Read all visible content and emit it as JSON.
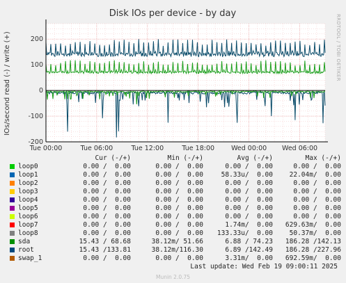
{
  "chart_data": {
    "type": "line",
    "title": "Disk IOs per device - by day",
    "ylabel": "IOs/second read (-) / write (+)",
    "ylim": [
      -200,
      260
    ],
    "yticks": [
      -200,
      -100,
      0,
      100,
      200
    ],
    "x_tick_labels": [
      "Tue 00:00",
      "Tue 06:00",
      "Tue 12:00",
      "Tue 18:00",
      "Wed 00:00",
      "Wed 06:00"
    ],
    "x_range_hours": [
      0,
      33
    ],
    "grid": true,
    "series": [
      {
        "name": "root",
        "color": "#0b4c6a",
        "write_typical": 140,
        "write_peak": 200,
        "read_typical": -10,
        "read_peak": -185
      },
      {
        "name": "sda",
        "color": "#1b9e1b",
        "write_typical": 70,
        "write_peak": 118,
        "read_typical": -5,
        "read_peak": -60
      }
    ]
  },
  "side_text": "RRDTOOL / TOBI OETIKER",
  "legend": {
    "headers": {
      "cur": "Cur (-/+)",
      "min": "Min (-/+)",
      "avg": "Avg (-/+)",
      "max": "Max (-/+)"
    },
    "rows": [
      {
        "name": "loop0",
        "color": "#00cc00",
        "cur": "0.00 /  0.00",
        "min": "0.00 /  0.00",
        "avg": "0.00 /  0.00",
        "max": "0.00 /  0.00"
      },
      {
        "name": "loop1",
        "color": "#0066b3",
        "cur": "0.00 /  0.00",
        "min": "0.00 /  0.00",
        "avg": "58.33u/  0.00",
        "max": "22.04m/  0.00"
      },
      {
        "name": "loop2",
        "color": "#ff8000",
        "cur": "0.00 /  0.00",
        "min": "0.00 /  0.00",
        "avg": "0.00 /  0.00",
        "max": "0.00 /  0.00"
      },
      {
        "name": "loop3",
        "color": "#ffcc00",
        "cur": "0.00 /  0.00",
        "min": "0.00 /  0.00",
        "avg": "0.00 /  0.00",
        "max": "0.00 /  0.00"
      },
      {
        "name": "loop4",
        "color": "#330099",
        "cur": "0.00 /  0.00",
        "min": "0.00 /  0.00",
        "avg": "0.00 /  0.00",
        "max": "0.00 /  0.00"
      },
      {
        "name": "loop5",
        "color": "#990099",
        "cur": "0.00 /  0.00",
        "min": "0.00 /  0.00",
        "avg": "0.00 /  0.00",
        "max": "0.00 /  0.00"
      },
      {
        "name": "loop6",
        "color": "#ccff00",
        "cur": "0.00 /  0.00",
        "min": "0.00 /  0.00",
        "avg": "0.00 /  0.00",
        "max": "0.00 /  0.00"
      },
      {
        "name": "loop7",
        "color": "#ff0000",
        "cur": "0.00 /  0.00",
        "min": "0.00 /  0.00",
        "avg": "1.74m/  0.00",
        "max": "629.63m/  0.00"
      },
      {
        "name": "loop8",
        "color": "#808080",
        "cur": "0.00 /  0.00",
        "min": "0.00 /  0.00",
        "avg": "133.33u/  0.00",
        "max": "50.37m/  0.00"
      },
      {
        "name": "sda",
        "color": "#008f00",
        "cur": "15.43 / 68.68",
        "min": "38.12m/ 51.66",
        "avg": "6.88 / 74.23",
        "max": "186.28 /142.13"
      },
      {
        "name": "root",
        "color": "#00487d",
        "cur": "15.43 /133.81",
        "min": "38.12m/116.30",
        "avg": "6.89 /142.49",
        "max": "186.28 /227.96"
      },
      {
        "name": "swap_1",
        "color": "#b35a00",
        "cur": "0.00 /  0.00",
        "min": "0.00 /  0.00",
        "avg": "3.31m/  0.00",
        "max": "692.59m/  0.00"
      }
    ]
  },
  "last_update": "Last update: Wed Feb 19 09:00:11 2025",
  "footer": "Munin 2.0.75"
}
